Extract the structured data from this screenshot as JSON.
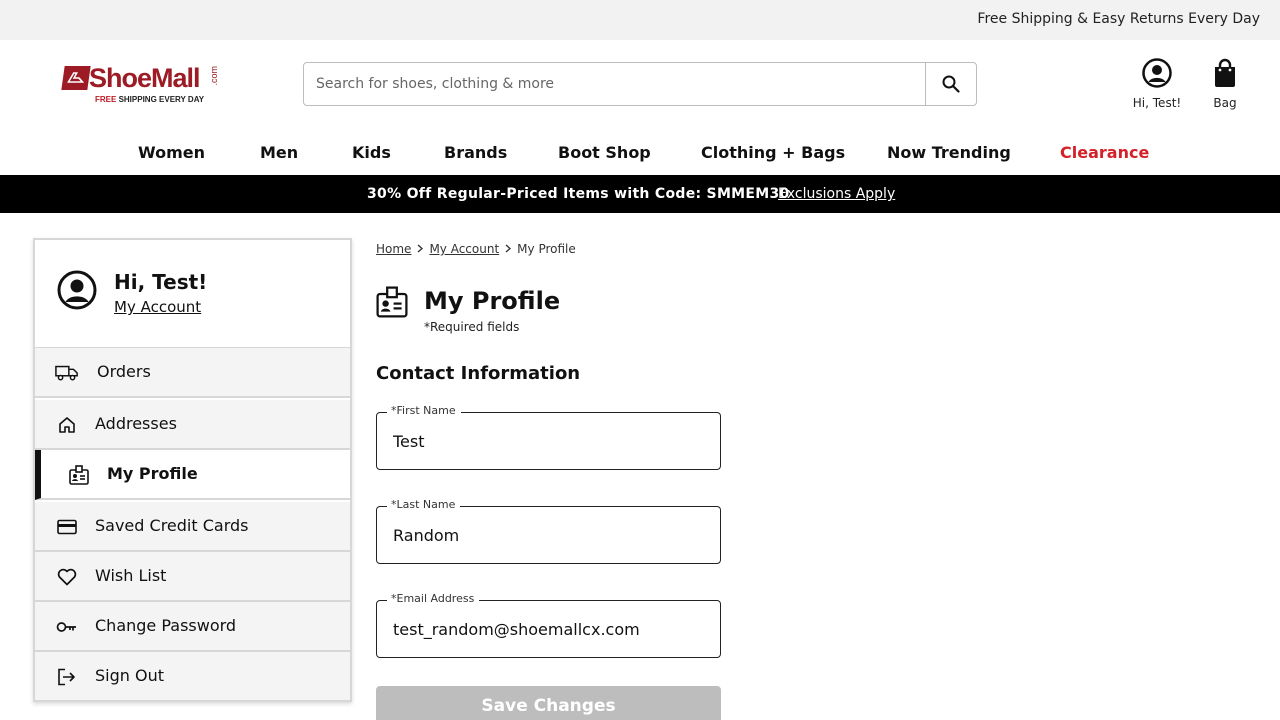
{
  "topbar": {
    "message": "Free Shipping & Easy Returns Every Day"
  },
  "logo": {
    "name": "ShoeMall",
    "suffix": ".com",
    "tag_free": "FREE",
    "tag_rest": " SHIPPING EVERY DAY"
  },
  "search": {
    "placeholder": "Search for shoes, clothing & more",
    "value": ""
  },
  "header": {
    "account_label": "Hi, Test!",
    "bag_label": "Bag"
  },
  "nav": {
    "items": [
      "Women",
      "Men",
      "Kids",
      "Brands",
      "Boot Shop",
      "Clothing + Bags",
      "Now Trending",
      "Clearance"
    ]
  },
  "promo": {
    "text": "30% Off Regular-Priced Items with Code: SMMEM30",
    "link": "Exclusions Apply"
  },
  "sidebar": {
    "greeting": "Hi, Test!",
    "account_link": "My Account",
    "items": [
      {
        "label": "Orders",
        "icon": "truck-icon"
      },
      {
        "label": "Addresses",
        "icon": "home-icon"
      },
      {
        "label": "My Profile",
        "icon": "id-badge-icon",
        "active": true
      },
      {
        "label": "Saved Credit Cards",
        "icon": "credit-card-icon"
      },
      {
        "label": "Wish List",
        "icon": "heart-icon"
      },
      {
        "label": "Change Password",
        "icon": "key-icon"
      },
      {
        "label": "Sign Out",
        "icon": "sign-out-icon"
      }
    ]
  },
  "breadcrumb": {
    "home": "Home",
    "account": "My Account",
    "current": "My Profile"
  },
  "page": {
    "title": "My Profile",
    "required_note": "*Required fields",
    "section_title": "Contact Information"
  },
  "form": {
    "first_name": {
      "label": "*First Name",
      "value": "Test"
    },
    "last_name": {
      "label": "*Last Name",
      "value": "Random"
    },
    "email": {
      "label": "*Email Address",
      "value": "test_random@shoemallcx.com"
    },
    "save_label": "Save Changes"
  },
  "colors": {
    "brand": "#9c1b24",
    "clearance": "#d62028",
    "promo_bg": "#000000",
    "save_disabled": "#bdbdbd"
  }
}
